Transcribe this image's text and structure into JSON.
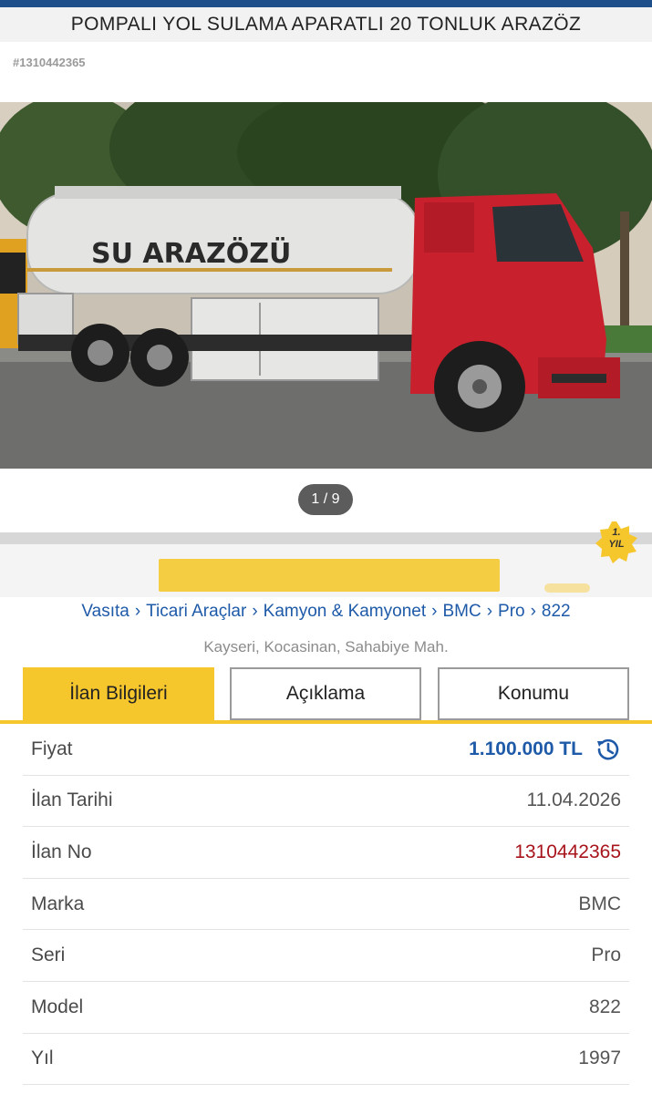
{
  "header": {
    "title": "POMPALI YOL SULAMA APARATLI 20 TONLUK ARAZÖZ",
    "listing_id_label": "#1310442365"
  },
  "gallery": {
    "truck_text": "SU ARAZÖZÜ",
    "pager": "1 / 9"
  },
  "badge": {
    "line1": "1.",
    "line2": "YIL"
  },
  "breadcrumb": {
    "items": [
      "Vasıta",
      "Ticari Araçlar",
      "Kamyon & Kamyonet",
      "BMC",
      "Pro",
      "822"
    ],
    "separator": "›"
  },
  "location": "Kayseri, Kocasinan, Sahabiye Mah.",
  "tabs": [
    {
      "label": "İlan Bilgileri",
      "active": true
    },
    {
      "label": "Açıklama",
      "active": false
    },
    {
      "label": "Konumu",
      "active": false
    }
  ],
  "info": [
    {
      "label": "Fiyat",
      "value": "1.100.000 TL"
    },
    {
      "label": "İlan Tarihi",
      "value": "11.04.2026"
    },
    {
      "label": "İlan No",
      "value": "1310442365"
    },
    {
      "label": "Marka",
      "value": "BMC"
    },
    {
      "label": "Seri",
      "value": "Pro"
    },
    {
      "label": "Model",
      "value": "822"
    },
    {
      "label": "Yıl",
      "value": "1997"
    }
  ],
  "colors": {
    "accent_yellow": "#f6c72c",
    "link_blue": "#1e5aa8",
    "id_red": "#a8141b",
    "truck_red": "#c8202c"
  },
  "icons": {
    "price_history": "history-icon"
  }
}
